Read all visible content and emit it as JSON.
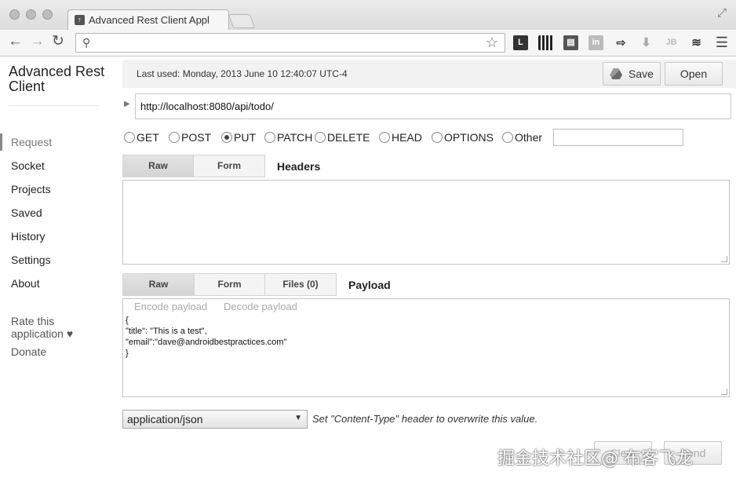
{
  "browser": {
    "tab_title": "Advanced Rest Client Appl",
    "url": "",
    "nav": {
      "back_icon": "←",
      "forward_icon": "→",
      "reload_icon": "↻"
    }
  },
  "sidebar": {
    "title": "Advanced Rest Client",
    "items": [
      {
        "label": "Request",
        "active": true
      },
      {
        "label": "Socket"
      },
      {
        "label": "Projects"
      },
      {
        "label": "Saved"
      },
      {
        "label": "History"
      },
      {
        "label": "Settings"
      },
      {
        "label": "About"
      }
    ],
    "rate_label": "Rate this application ♥",
    "donate_label": "Donate"
  },
  "header": {
    "last_used": "Last used: Monday, 2013 June 10 12:40:07 UTC-4",
    "save_label": "Save",
    "open_label": "Open"
  },
  "request": {
    "url": "http://localhost:8080/api/todo/",
    "methods": [
      "GET",
      "POST",
      "PUT",
      "PATCH",
      "DELETE",
      "HEAD",
      "OPTIONS",
      "Other"
    ],
    "selected_method": "PUT",
    "other_value": ""
  },
  "headers_section": {
    "tabs": [
      "Raw",
      "Form"
    ],
    "active_tab": "Raw",
    "label": "Headers",
    "value": ""
  },
  "payload_section": {
    "tabs": [
      "Raw",
      "Form",
      "Files (0)"
    ],
    "active_tab": "Raw",
    "label": "Payload",
    "encode_label": "Encode payload",
    "decode_label": "Decode payload",
    "body": "{\n\"title\": \"This is a test\",\n\"email\":\"dave@androidbestpractices.com\"\n}"
  },
  "content_type": {
    "selected": "application/json",
    "hint": "Set \"Content-Type\" header to overwrite this value."
  },
  "footer": {
    "clear_label": "Clear",
    "send_label": "Send"
  },
  "watermark": "掘金技术社区@ 布客飞龙",
  "colors": {
    "chrome_bg": "#dcdcdc",
    "accent_bar": "#f2f2f2"
  }
}
